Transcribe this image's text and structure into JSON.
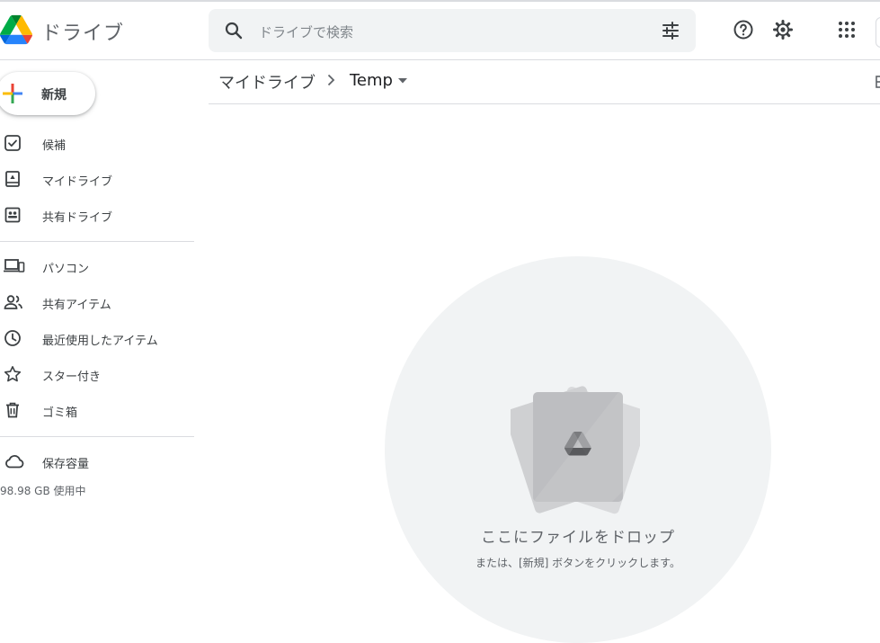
{
  "header": {
    "app_title": "ドライブ",
    "search_placeholder": "ドライブで検索"
  },
  "new_button": {
    "label": "新規"
  },
  "nav": {
    "items": [
      {
        "label": "候補",
        "icon": "suggested-check-icon"
      },
      {
        "label": "マイドライブ",
        "icon": "my-drive-icon"
      },
      {
        "label": "共有ドライブ",
        "icon": "shared-drives-icon"
      },
      {
        "label": "パソコン",
        "icon": "computers-icon"
      },
      {
        "label": "共有アイテム",
        "icon": "people-icon"
      },
      {
        "label": "最近使用したアイテム",
        "icon": "clock-icon"
      },
      {
        "label": "スター付き",
        "icon": "star-icon"
      },
      {
        "label": "ゴミ箱",
        "icon": "trash-icon"
      }
    ],
    "storage": {
      "label": "保存容量",
      "usage": "98.98 GB 使用中"
    }
  },
  "breadcrumb": {
    "root": "マイドライブ",
    "current": "Temp"
  },
  "empty_state": {
    "title": "ここにファイルをドロップ",
    "subtitle": "または、[新規] ボタンをクリックします。"
  },
  "colors": {
    "blue": "#4285f4",
    "red": "#ea4335",
    "yellow": "#fbbc04",
    "green": "#34a853",
    "icon_gray": "#5f6368"
  }
}
